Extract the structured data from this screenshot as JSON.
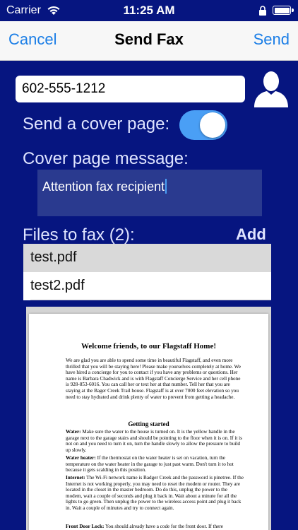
{
  "status_bar": {
    "carrier": "Carrier",
    "time": "11:25 AM"
  },
  "nav": {
    "cancel_label": "Cancel",
    "title": "Send Fax",
    "send_label": "Send"
  },
  "fax_number": {
    "value": "602-555-1212"
  },
  "cover_page": {
    "label": "Send a cover page:",
    "enabled": true
  },
  "cover_message": {
    "label": "Cover page message:",
    "value": "Attention fax recipient"
  },
  "files": {
    "label": "Files to fax (2):",
    "add_label": "Add",
    "items": [
      {
        "name": "test.pdf",
        "selected": true
      },
      {
        "name": "test2.pdf",
        "selected": false
      }
    ]
  },
  "preview": {
    "title": "Welcome friends, to our Flagstaff Home!",
    "intro": "We are glad you are able to spend some time in beautiful Flagstaff, and even more thrilled that you will be staying here!  Please make yourselves completely at home.  We have hired a concierge for you to contact if you have any problems or questions.  Her name is Barbara Chadwick and is with Flagstaff Concierge Service and her cell phone is 928-853-6016.  You can call her or text her at that number.  Tell her that you are staying at the Bager Creek Trail house.  Flagstaff is at over 7000 feet elevation so you need to stay hydrated and drink plenty of water to prevent from getting a headache.",
    "section_heading": "Getting started",
    "water_label": "Water:",
    "water_text": " Make sure the water to the house is turned on.  It is the yellow handle in the garage next to the garage stairs and should be pointing to the floor when it is on.  If it is not on and you need to turn it on, turn the handle slowly to allow the pressure to build up slowly.",
    "heater_label": "Water heater:",
    "heater_text": " If the thermostat on the water heater is set on vacation, turn the temperature on the water heater in the garage to just past warm.  Don't turn it to hot because it gets scalding in this position.",
    "internet_label": "Internet:",
    "internet_text": " The Wi-Fi network name is Badger Creek and the password is pinetree.  If the Internet is not working properly, you may need to reset the modem or router.  They are located in the closet in the master bedroom.  Do do this, unplug the power to the modem, wait a couple of seconds and plug it back in.  Wait about a minute for all the lights to go green.  Then unplug the power to the wireless access point and plug it back in.  Wait a couple of minutes and try to connect again.",
    "door_label": "Front Door Lock:",
    "door_text": " You should already have a code for the front door.  If there"
  },
  "colors": {
    "background": "#061580",
    "accent": "#1b7ee6",
    "toggle_on": "#4a9ff5"
  },
  "icons": {
    "wifi": "wifi-icon",
    "battery": "battery-icon",
    "lock": "orientation-lock-icon",
    "contact": "contact-person-icon"
  }
}
